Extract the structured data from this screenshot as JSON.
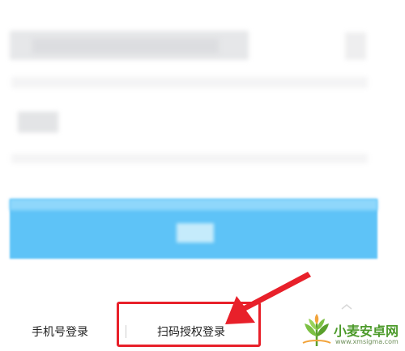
{
  "login_options": {
    "phone_login": "手机号登录",
    "qr_login": "扫码授权登录"
  },
  "watermark": {
    "name": "小麦安卓网",
    "url": "www.xmsigma.com"
  },
  "colors": {
    "login_button": "#5ec3f7",
    "highlight": "#e8202a",
    "watermark_green": "#4c9a2a"
  },
  "icons": {
    "arrow": "red-arrow-icon",
    "chevron": "chevron-up-icon",
    "logo": "wheat-logo-icon"
  }
}
